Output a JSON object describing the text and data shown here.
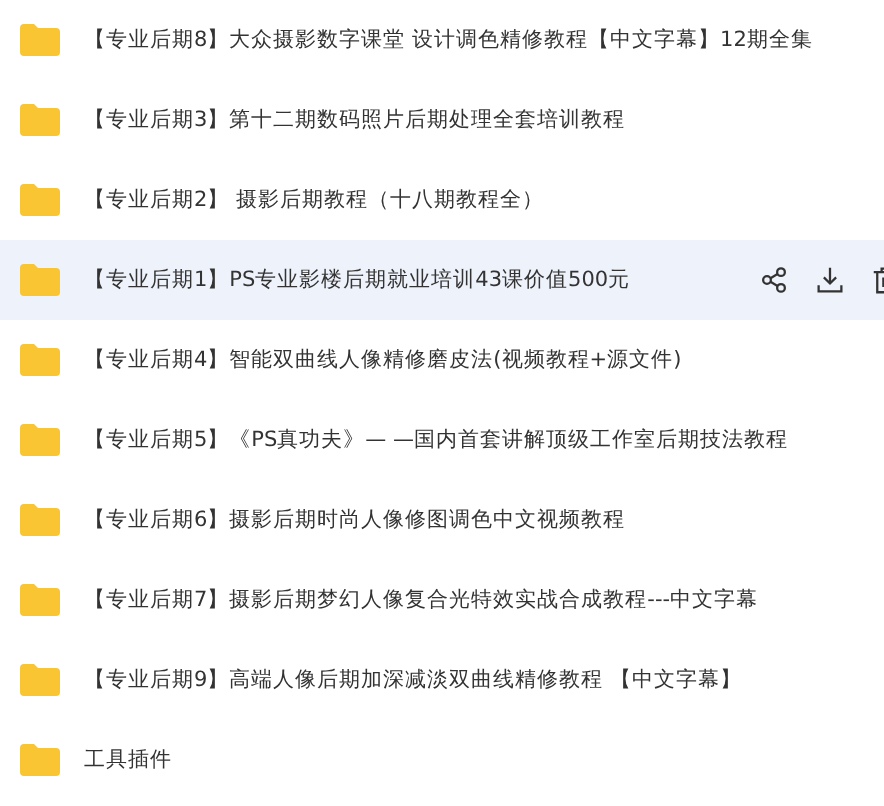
{
  "folders": [
    {
      "name": "【专业后期8】大众摄影数字课堂 设计调色精修教程【中文字幕】12期全集",
      "selected": false
    },
    {
      "name": "【专业后期3】第十二期数码照片后期处理全套培训教程",
      "selected": false
    },
    {
      "name": "【专业后期2】 摄影后期教程（十八期教程全）",
      "selected": false
    },
    {
      "name": "【专业后期1】PS专业影楼后期就业培训43课价值500元",
      "selected": true
    },
    {
      "name": "【专业后期4】智能双曲线人像精修磨皮法(视频教程+源文件)",
      "selected": false
    },
    {
      "name": "【专业后期5】《PS真功夫》— —国内首套讲解顶级工作室后期技法教程",
      "selected": false
    },
    {
      "name": "【专业后期6】摄影后期时尚人像修图调色中文视频教程",
      "selected": false
    },
    {
      "name": "【专业后期7】摄影后期梦幻人像复合光特效实战合成教程---中文字幕",
      "selected": false
    },
    {
      "name": "【专业后期9】高端人像后期加深减淡双曲线精修教程 【中文字幕】",
      "selected": false
    },
    {
      "name": "工具插件",
      "selected": false
    }
  ]
}
